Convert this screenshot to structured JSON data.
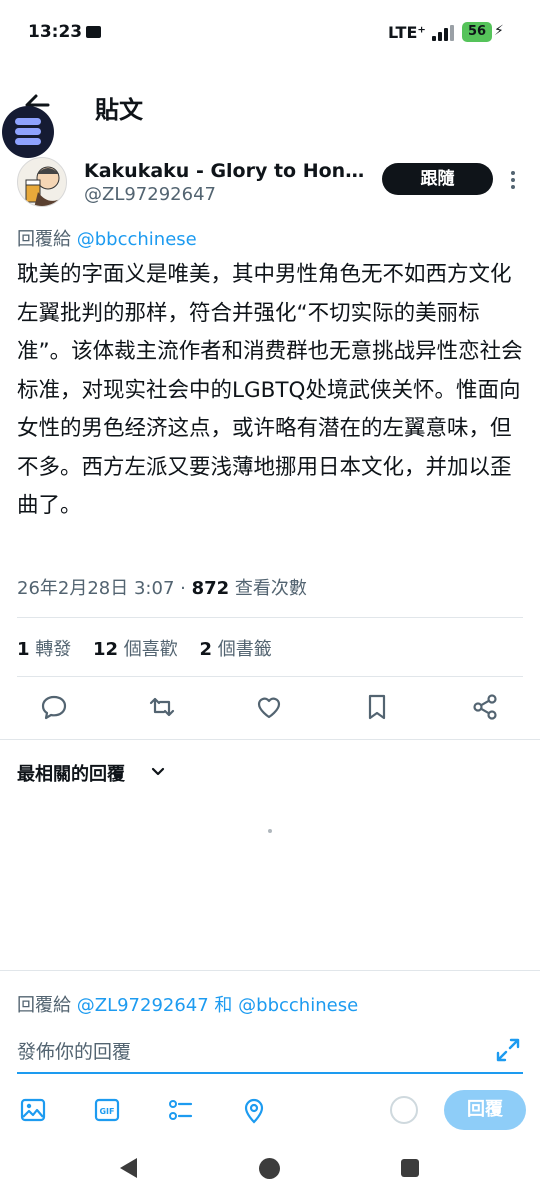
{
  "status_bar": {
    "time": "13:23",
    "network": "LTE⁺",
    "battery": "56"
  },
  "header": {
    "title": "貼文"
  },
  "author": {
    "name": "Kakukaku - Glory to Hong...",
    "handle": "@ZL97292647",
    "follow_label": "跟隨"
  },
  "reply_to": {
    "prefix": "回覆給 ",
    "user": "@bbcchinese"
  },
  "tweet": {
    "text": "耽美的字面义是唯美，其中男性角色无不如西方文化左翼批判的那样，符合并强化“不切实际的美丽标准”。该体裁主流作者和消费群也无意挑战异性恋社会标准，对现实社会中的LGBTQ处境武侠关怀。惟面向女性的男色经济这点，或许略有潜在的左翼意味，但不多。西方左派又要浅薄地挪用日本文化，并加以歪曲了。",
    "timestamp": "26年2月28日 3:07 · ",
    "views": "872",
    "views_label": " 查看次數"
  },
  "stats": {
    "retweets": "1",
    "retweets_label": " 轉發",
    "likes": "12",
    "likes_label": " 個喜歡",
    "bookmarks": "2",
    "bookmarks_label": " 個書籤"
  },
  "replies": {
    "sort_label": "最相關的回覆"
  },
  "composer": {
    "reply_prefix": "回覆給 ",
    "reply_users": "@ZL97292647 和 @bbcchinese",
    "placeholder": "發佈你的回覆",
    "submit_label": "回覆"
  },
  "colors": {
    "accent": "#1d9bf0",
    "text_primary": "#0f1419",
    "text_secondary": "#536471",
    "reply_button_disabled": "#8ecdf8"
  },
  "icons": [
    "back-arrow-icon",
    "more-icon",
    "reply-icon",
    "retweet-icon",
    "like-icon",
    "bookmark-icon",
    "share-icon",
    "chevron-down-icon",
    "expand-icon",
    "image-icon",
    "gif-icon",
    "poll-icon",
    "location-icon"
  ]
}
